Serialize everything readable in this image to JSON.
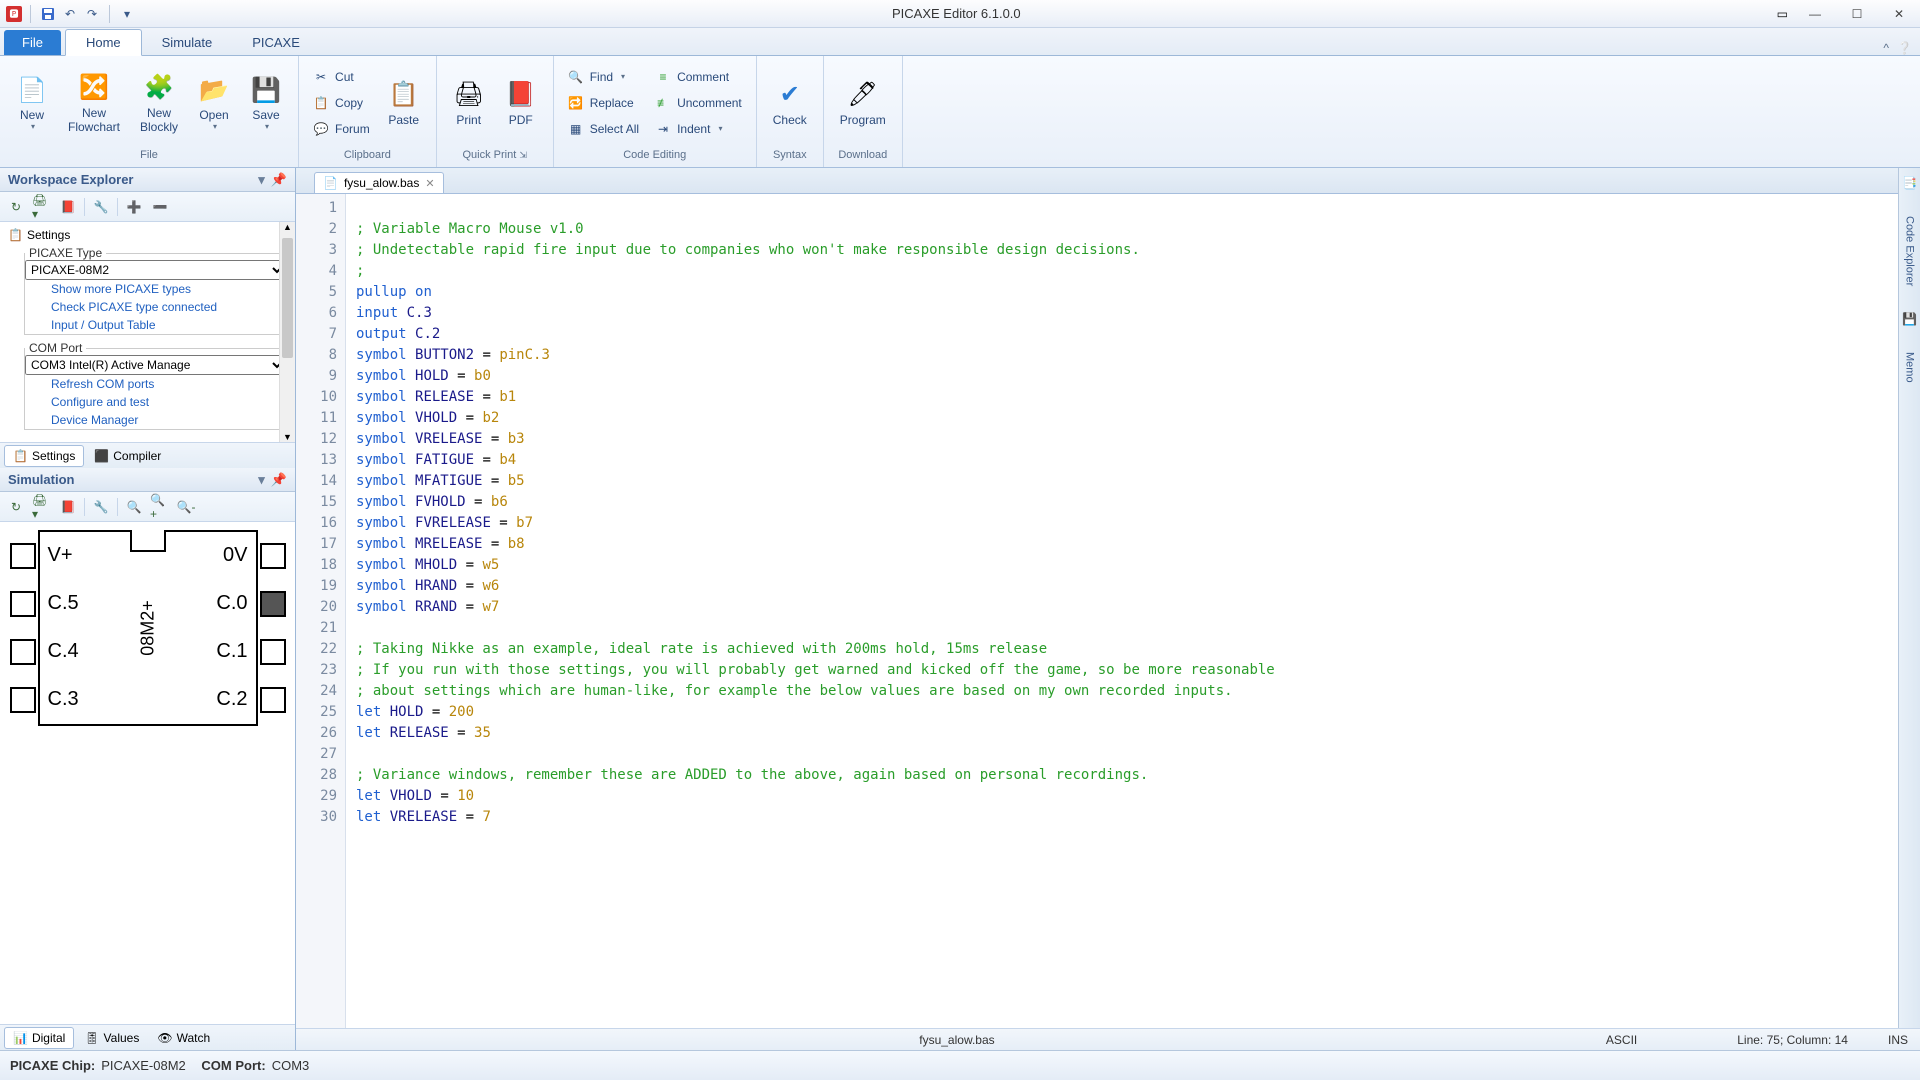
{
  "app": {
    "title": "PICAXE Editor 6.1.0.0"
  },
  "tabs": {
    "file": "File",
    "home": "Home",
    "simulate": "Simulate",
    "picaxe": "PICAXE"
  },
  "ribbon": {
    "file": {
      "label": "File",
      "new": "New",
      "new_flowchart": "New\nFlowchart",
      "new_blockly": "New\nBlockly",
      "open": "Open",
      "save": "Save"
    },
    "clipboard": {
      "label": "Clipboard",
      "cut": "Cut",
      "copy": "Copy",
      "forum": "Forum",
      "paste": "Paste"
    },
    "quickprint": {
      "label": "Quick Print",
      "print": "Print",
      "pdf": "PDF"
    },
    "codeediting": {
      "label": "Code Editing",
      "find": "Find",
      "replace": "Replace",
      "selectall": "Select All",
      "comment": "Comment",
      "uncomment": "Uncomment",
      "indent": "Indent"
    },
    "syntax": {
      "label": "Syntax",
      "check": "Check"
    },
    "download": {
      "label": "Download",
      "program": "Program"
    }
  },
  "workspace": {
    "title": "Workspace Explorer",
    "settings_root": "Settings",
    "picaxe_type_label": "PICAXE Type",
    "picaxe_type_value": "PICAXE-08M2",
    "show_more": "Show more PICAXE types",
    "check_type": "Check PICAXE type connected",
    "io_table": "Input / Output Table",
    "com_port_label": "COM Port",
    "com_port_value": "COM3 Intel(R) Active Manage",
    "refresh_com": "Refresh COM ports",
    "configure": "Configure and test",
    "device_mgr": "Device Manager",
    "sim_label_cut": "Simulation",
    "tab_settings": "Settings",
    "tab_compiler": "Compiler"
  },
  "simulation": {
    "title": "Simulation",
    "chip_name": "08M2+",
    "pins": {
      "vplus": "V+",
      "zero_v": "0V",
      "c5": "C.5",
      "c0": "C.0",
      "c4": "C.4",
      "c1": "C.1",
      "c3": "C.3",
      "c2": "C.2"
    },
    "tab_digital": "Digital",
    "tab_values": "Values",
    "tab_watch": "Watch"
  },
  "doc": {
    "filename": "fysu_alow.bas"
  },
  "code": {
    "lines": [
      {
        "n": 1,
        "t": ""
      },
      {
        "n": 2,
        "t": "; Variable Macro Mouse v1.0",
        "cls": "c-comment"
      },
      {
        "n": 3,
        "t": "; Undetectable rapid fire input due to companies who won't make responsible design decisions.",
        "cls": "c-comment"
      },
      {
        "n": 4,
        "t": ";",
        "cls": "c-comment"
      },
      {
        "n": 5,
        "html": "<span class='c-keyword'>pullup</span> <span class='c-keyword'>on</span>"
      },
      {
        "n": 6,
        "html": "<span class='c-keyword'>input</span> <span class='c-ident'>C.3</span>"
      },
      {
        "n": 7,
        "html": "<span class='c-keyword'>output</span> <span class='c-ident'>C.2</span>"
      },
      {
        "n": 8,
        "html": "<span class='c-keyword'>symbol</span> <span class='c-ident'>BUTTON2</span> = <span class='c-const'>pinC.3</span>"
      },
      {
        "n": 9,
        "html": "<span class='c-keyword'>symbol</span> <span class='c-ident'>HOLD</span> = <span class='c-const'>b0</span>"
      },
      {
        "n": 10,
        "html": "<span class='c-keyword'>symbol</span> <span class='c-ident'>RELEASE</span> = <span class='c-const'>b1</span>"
      },
      {
        "n": 11,
        "html": "<span class='c-keyword'>symbol</span> <span class='c-ident'>VHOLD</span> = <span class='c-const'>b2</span>"
      },
      {
        "n": 12,
        "html": "<span class='c-keyword'>symbol</span> <span class='c-ident'>VRELEASE</span> = <span class='c-const'>b3</span>"
      },
      {
        "n": 13,
        "html": "<span class='c-keyword'>symbol</span> <span class='c-ident'>FATIGUE</span> = <span class='c-const'>b4</span>"
      },
      {
        "n": 14,
        "html": "<span class='c-keyword'>symbol</span> <span class='c-ident'>MFATIGUE</span> = <span class='c-const'>b5</span>"
      },
      {
        "n": 15,
        "html": "<span class='c-keyword'>symbol</span> <span class='c-ident'>FVHOLD</span> = <span class='c-const'>b6</span>"
      },
      {
        "n": 16,
        "html": "<span class='c-keyword'>symbol</span> <span class='c-ident'>FVRELEASE</span> = <span class='c-const'>b7</span>"
      },
      {
        "n": 17,
        "html": "<span class='c-keyword'>symbol</span> <span class='c-ident'>MRELEASE</span> = <span class='c-const'>b8</span>"
      },
      {
        "n": 18,
        "html": "<span class='c-keyword'>symbol</span> <span class='c-ident'>MHOLD</span> = <span class='c-const'>w5</span>"
      },
      {
        "n": 19,
        "html": "<span class='c-keyword'>symbol</span> <span class='c-ident'>HRAND</span> = <span class='c-const'>w6</span>"
      },
      {
        "n": 20,
        "html": "<span class='c-keyword'>symbol</span> <span class='c-ident'>RRAND</span> = <span class='c-const'>w7</span>"
      },
      {
        "n": 21,
        "t": ""
      },
      {
        "n": 22,
        "t": "; Taking Nikke as an example, ideal rate is achieved with 200ms hold, 15ms release",
        "cls": "c-comment"
      },
      {
        "n": 23,
        "t": "; If you run with those settings, you will probably get warned and kicked off the game, so be more reasonable",
        "cls": "c-comment"
      },
      {
        "n": 24,
        "t": "; about settings which are human-like, for example the below values are based on my own recorded inputs.",
        "cls": "c-comment"
      },
      {
        "n": 25,
        "html": "<span class='c-keyword'>let</span> <span class='c-ident'>HOLD</span> = <span class='c-const'>200</span>"
      },
      {
        "n": 26,
        "html": "<span class='c-keyword'>let</span> <span class='c-ident'>RELEASE</span> = <span class='c-const'>35</span>"
      },
      {
        "n": 27,
        "t": ""
      },
      {
        "n": 28,
        "t": "; Variance windows, remember these are ADDED to the above, again based on personal recordings.",
        "cls": "c-comment"
      },
      {
        "n": 29,
        "html": "<span class='c-keyword'>let</span> <span class='c-ident'>VHOLD</span> = <span class='c-const'>10</span>"
      },
      {
        "n": 30,
        "html": "<span class='c-keyword'>let</span> <span class='c-ident'>VRELEASE</span> = <span class='c-const'>7</span>"
      }
    ]
  },
  "status": {
    "encoding": "ASCII",
    "position": "Line:   75; Column:   14",
    "ins": "INS",
    "chip_label": "PICAXE Chip:",
    "chip_value": "PICAXE-08M2",
    "com_label": "COM Port:",
    "com_value": "COM3"
  },
  "right_tabs": {
    "code_explorer": "Code Explorer",
    "memory": "Memo"
  }
}
